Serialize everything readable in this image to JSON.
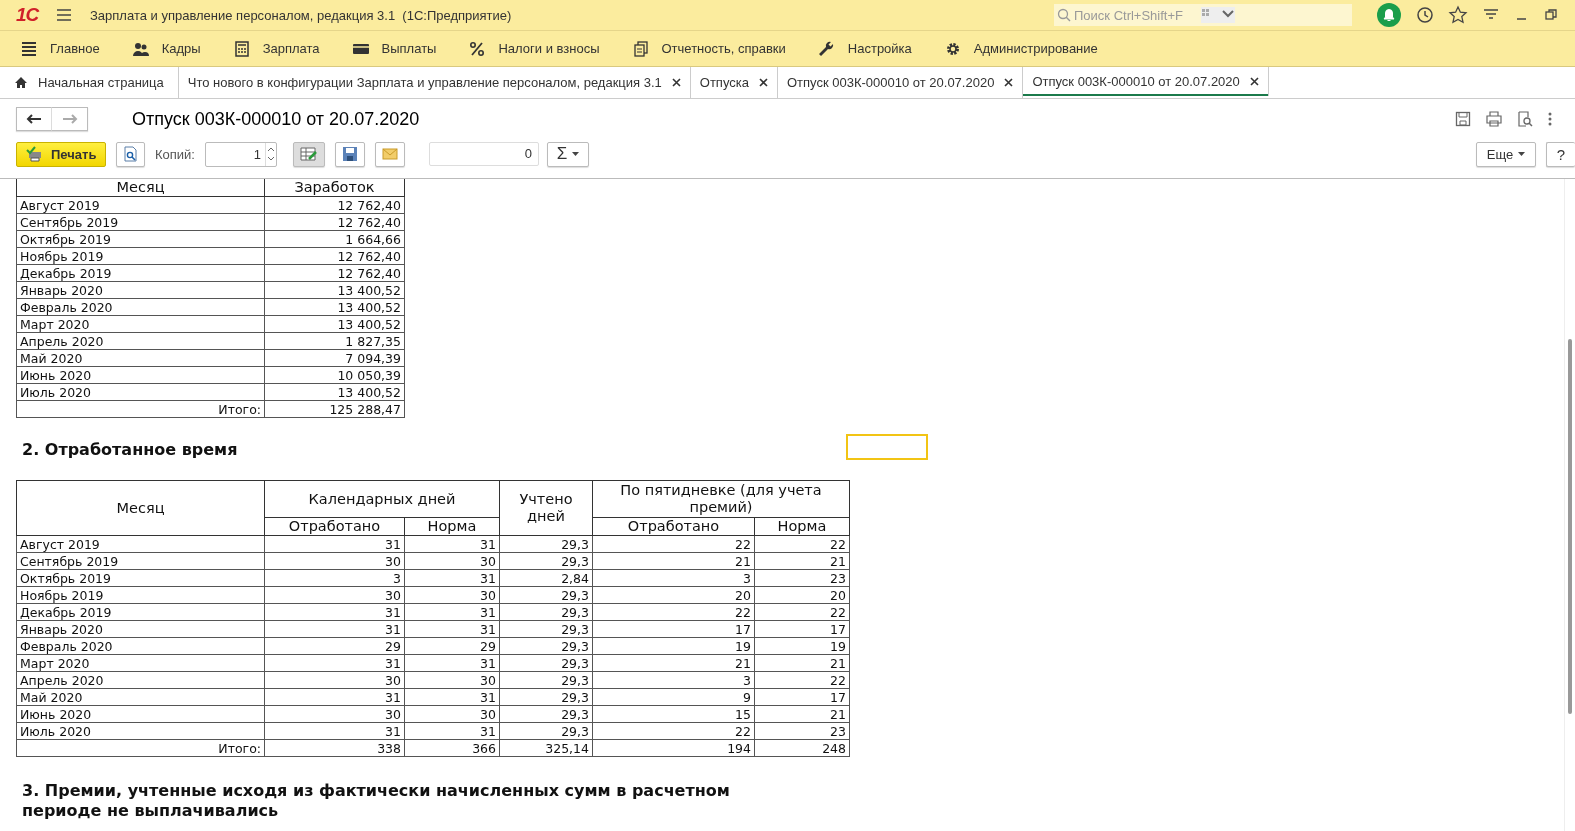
{
  "window": {
    "logo": "1С",
    "title": "Зарплата и управление персоналом, редакция 3.1  (1С:Предприятие)",
    "search": {
      "placeholder": "Поиск Ctrl+Shift+F"
    }
  },
  "sections": [
    "Главное",
    "Кадры",
    "Зарплата",
    "Выплаты",
    "Налоги и взносы",
    "Отчетность, справки",
    "Настройка",
    "Администрирование"
  ],
  "tabs": [
    {
      "label": "Начальная страница",
      "selected": false,
      "closable": false
    },
    {
      "label": "Что нового в конфигурации Зарплата и управление персоналом, редакция 3.1",
      "selected": false,
      "closable": true
    },
    {
      "label": "Отпуска",
      "selected": false,
      "closable": true
    },
    {
      "label": "Отпуск 003К-000010 от 20.07.2020",
      "selected": false,
      "closable": true
    },
    {
      "label": "Отпуск 003К-000010 от 20.07.2020",
      "selected": true,
      "closable": true
    }
  ],
  "document": {
    "title": "Отпуск 003К-000010 от 20.07.2020",
    "print": "Печать",
    "copies_label": "Копий:",
    "copies": "1",
    "sum": "0",
    "sum_button": "Σ",
    "more": "Еще",
    "help": "?"
  },
  "report": {
    "earnings": {
      "columns": [
        "Месяц",
        "Заработок"
      ],
      "rows": [
        [
          "Август 2019",
          "12 762,40"
        ],
        [
          "Сентябрь 2019",
          "12 762,40"
        ],
        [
          "Октябрь 2019",
          "1 664,66"
        ],
        [
          "Ноябрь 2019",
          "12 762,40"
        ],
        [
          "Декабрь 2019",
          "12 762,40"
        ],
        [
          "Январь 2020",
          "13 400,52"
        ],
        [
          "Февраль 2020",
          "13 400,52"
        ],
        [
          "Март 2020",
          "13 400,52"
        ],
        [
          "Апрель 2020",
          "1 827,35"
        ],
        [
          "Май 2020",
          "7 094,39"
        ],
        [
          "Июнь 2020",
          "10 050,39"
        ],
        [
          "Июль 2020",
          "13 400,52"
        ]
      ],
      "total": [
        "Итого:",
        "125 288,47"
      ]
    },
    "section_2": "2. Отработанное время",
    "worktime": {
      "month": "Месяц",
      "calendar": "Календарных дней",
      "counted": "Учтено дней",
      "five_day": "По пятидневке (для учета премий)",
      "subcolumns": [
        "Отработано",
        "Норма",
        "Отработано",
        "Норма"
      ],
      "rows": [
        [
          "Август 2019",
          "31",
          "31",
          "29,3",
          "22",
          "22"
        ],
        [
          "Сентябрь 2019",
          "30",
          "30",
          "29,3",
          "21",
          "21"
        ],
        [
          "Октябрь 2019",
          "3",
          "31",
          "2,84",
          "3",
          "23"
        ],
        [
          "Ноябрь 2019",
          "30",
          "30",
          "29,3",
          "20",
          "20"
        ],
        [
          "Декабрь 2019",
          "31",
          "31",
          "29,3",
          "22",
          "22"
        ],
        [
          "Январь 2020",
          "31",
          "31",
          "29,3",
          "17",
          "17"
        ],
        [
          "Февраль 2020",
          "29",
          "29",
          "29,3",
          "19",
          "19"
        ],
        [
          "Март 2020",
          "31",
          "31",
          "29,3",
          "21",
          "21"
        ],
        [
          "Апрель 2020",
          "30",
          "30",
          "29,3",
          "3",
          "22"
        ],
        [
          "Май 2020",
          "31",
          "31",
          "29,3",
          "9",
          "17"
        ],
        [
          "Июнь 2020",
          "30",
          "30",
          "29,3",
          "15",
          "21"
        ],
        [
          "Июль 2020",
          "31",
          "31",
          "29,3",
          "22",
          "23"
        ]
      ],
      "total": [
        "Итого:",
        "338",
        "366",
        "325,14",
        "194",
        "248"
      ]
    },
    "section_3": "3. Премии, учтенные исходя из фактически начисленных сумм в расчетном периоде не выплачивались"
  }
}
